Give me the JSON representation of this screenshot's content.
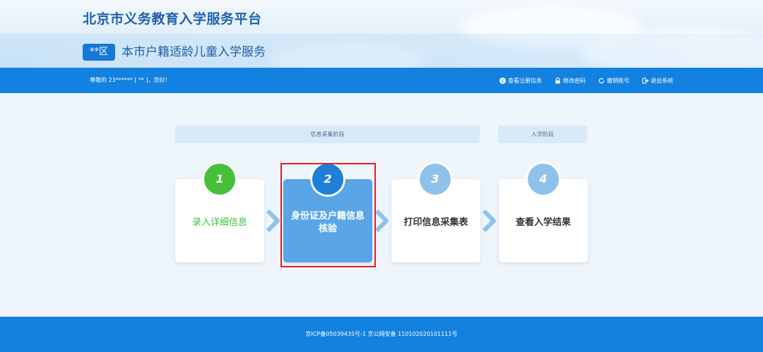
{
  "header": {
    "site_title": "北京市义务教育入学服务平台",
    "district_badge": "**区",
    "service_title": "本市户籍适龄儿童入学服务"
  },
  "navbar": {
    "greeting": "尊敬的 23****** [ ** ]，您好!",
    "links": [
      {
        "label": "查看注册信息",
        "icon": "info-icon"
      },
      {
        "label": "修改密码",
        "icon": "lock-icon"
      },
      {
        "label": "撤销账号",
        "icon": "refresh-icon"
      },
      {
        "label": "退出系统",
        "icon": "logout-icon"
      }
    ]
  },
  "stages": {
    "info_collection": "信息采集阶段",
    "enrollment": "入学阶段"
  },
  "steps": [
    {
      "number": "1",
      "label": "录入详细信息",
      "status": "done"
    },
    {
      "number": "2",
      "label": "身份证及户籍信息核验",
      "status": "active"
    },
    {
      "number": "3",
      "label": "打印信息采集表",
      "status": "pending"
    },
    {
      "number": "4",
      "label": "查看入学结果",
      "status": "pending"
    }
  ],
  "footer": {
    "icp": "京ICP备05039435号-1 京公网安备 110102020101111号"
  },
  "colors": {
    "primary": "#1381e0",
    "done": "#46c03b",
    "active_card": "#5aa5e6",
    "highlight": "#e0201e"
  }
}
